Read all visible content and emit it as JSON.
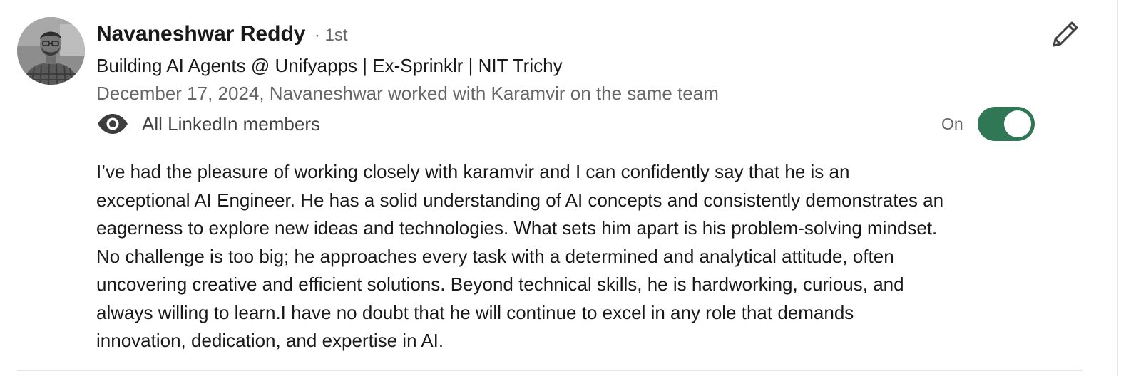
{
  "recommendation": {
    "author_name": "Navaneshwar Reddy",
    "connection_degree": "· 1st",
    "headline": "Building AI Agents @ Unifyapps | Ex-Sprinklr | NIT Trichy",
    "meta": "December 17, 2024, Navaneshwar worked with Karamvir on the same team",
    "visibility_label": "All LinkedIn members",
    "toggle_state_label": "On",
    "toggle_on": true,
    "body_lines": [
      "I’ve had the pleasure of working closely with karamvir and I can confidently say that he is an",
      "exceptional AI Engineer. He has a solid understanding of AI concepts and consistently demonstrates an",
      "eagerness to explore new ideas and technologies. What sets him apart is his problem-solving mindset.",
      "No challenge is too big; he approaches every task with a determined and analytical attitude, often",
      "uncovering creative and efficient solutions. Beyond technical skills, he is hardworking, curious, and",
      "always willing to learn.I have no doubt that he will continue to excel in any role that demands",
      "innovation, dedication, and expertise in AI."
    ]
  },
  "icons": {
    "edit": "pencil-icon",
    "visibility": "eye-icon"
  },
  "colors": {
    "toggle_on": "#2f7755",
    "text_primary": "rgba(0,0,0,0.9)",
    "text_secondary": "rgba(0,0,0,0.6)"
  }
}
